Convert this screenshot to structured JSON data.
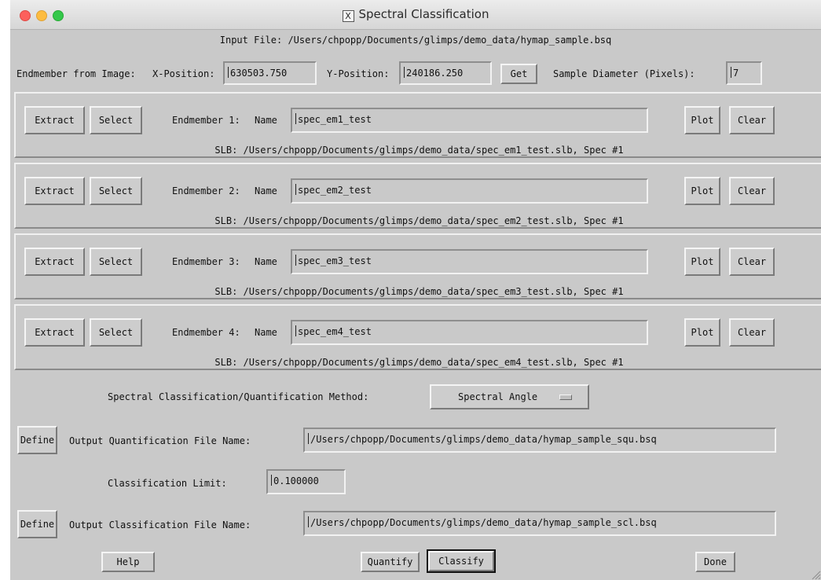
{
  "window": {
    "title": "Spectral Classification"
  },
  "input_file": "Input File: /Users/chpopp/Documents/glimps/demo_data/hymap_sample.bsq",
  "endmember_from_image": {
    "label": "Endmember from Image:",
    "x_label": "X-Position:",
    "x_value": "630503.750",
    "y_label": "Y-Position:",
    "y_value": "240186.250",
    "get_label": "Get",
    "diameter_label": "Sample Diameter (Pixels):",
    "diameter_value": "7"
  },
  "endmembers": [
    {
      "extract": "Extract",
      "select": "Select",
      "label": "Endmember 1:",
      "name_label": "Name",
      "name": "spec_em1_test",
      "plot": "Plot",
      "clear": "Clear",
      "slb": "SLB: /Users/chpopp/Documents/glimps/demo_data/spec_em1_test.slb, Spec #1"
    },
    {
      "extract": "Extract",
      "select": "Select",
      "label": "Endmember 2:",
      "name_label": "Name",
      "name": "spec_em2_test",
      "plot": "Plot",
      "clear": "Clear",
      "slb": "SLB: /Users/chpopp/Documents/glimps/demo_data/spec_em2_test.slb, Spec #1"
    },
    {
      "extract": "Extract",
      "select": "Select",
      "label": "Endmember 3:",
      "name_label": "Name",
      "name": "spec_em3_test",
      "plot": "Plot",
      "clear": "Clear",
      "slb": "SLB: /Users/chpopp/Documents/glimps/demo_data/spec_em3_test.slb, Spec #1"
    },
    {
      "extract": "Extract",
      "select": "Select",
      "label": "Endmember 4:",
      "name_label": "Name",
      "name": "spec_em4_test",
      "plot": "Plot",
      "clear": "Clear",
      "slb": "SLB: /Users/chpopp/Documents/glimps/demo_data/spec_em4_test.slb, Spec #1"
    }
  ],
  "method": {
    "label": "Spectral Classification/Quantification Method:",
    "value": "Spectral Angle"
  },
  "quant_output": {
    "define": "Define",
    "label": "Output Quantification File Name:",
    "value": "/Users/chpopp/Documents/glimps/demo_data/hymap_sample_squ.bsq"
  },
  "class_limit": {
    "label": "Classification Limit:",
    "value": "0.100000"
  },
  "class_output": {
    "define": "Define",
    "label": "Output Classification File Name:",
    "value": "/Users/chpopp/Documents/glimps/demo_data/hymap_sample_scl.bsq"
  },
  "footer": {
    "help": "Help",
    "quantify": "Quantify",
    "classify": "Classify",
    "done": "Done"
  }
}
